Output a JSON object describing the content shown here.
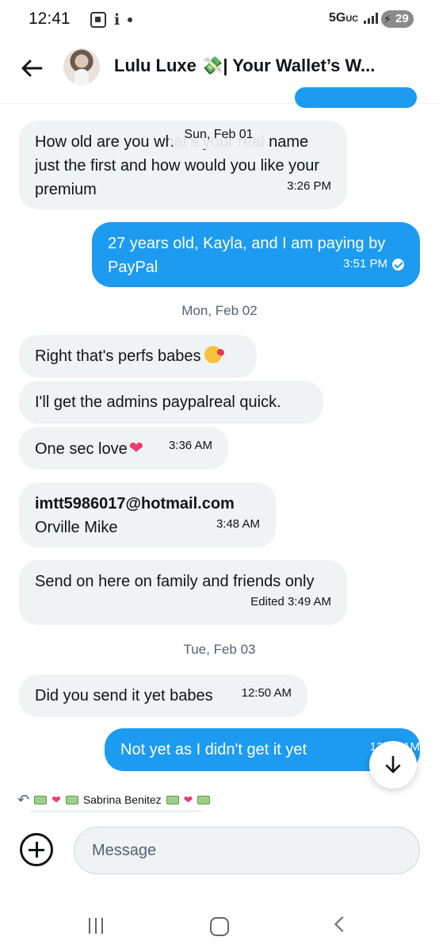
{
  "status_bar": {
    "time": "12:41",
    "network": "5G",
    "network_sub": "UC",
    "battery": "29"
  },
  "header": {
    "title": "Lulu Luxe 💸| Your Wallet’s W..."
  },
  "floating_date": "Sun, Feb 01",
  "messages": [
    {
      "direction": "in",
      "text": "How old are you what's your real name just the first and how would you like your premium",
      "time": "3:26 PM"
    },
    {
      "direction": "out",
      "text": "27 years old, Kayla, and I am paying by PayPal",
      "time": "3:51 PM",
      "status": "read"
    },
    {
      "type": "date",
      "text": "Mon, Feb 02"
    },
    {
      "direction": "in",
      "text": "Right that's perfs babes"
    },
    {
      "direction": "in",
      "text": "I'll get the admins paypalreal quick."
    },
    {
      "direction": "in",
      "text": "One sec love",
      "time": "3:36 AM"
    },
    {
      "direction": "in",
      "line1": "imtt5986017@hotmail.com",
      "line2": "Orville Mike",
      "time": "3:48 AM"
    },
    {
      "direction": "in",
      "text": "Send on here on family and friends only",
      "time": "Edited 3:49 AM"
    },
    {
      "type": "date",
      "text": "Tue, Feb 03"
    },
    {
      "direction": "in",
      "text": "Did you send it yet babes",
      "time": "12:50 AM"
    },
    {
      "direction": "out",
      "text": "Not yet as I didn't get it yet",
      "time": "12:56 AM"
    }
  ],
  "reply_preview": {
    "name": "Sabrina Benitez"
  },
  "composer": {
    "placeholder": "Message"
  },
  "icons": {
    "back": "arrow-left-icon",
    "add": "plus-circle-icon",
    "scroll": "arrow-down-icon"
  },
  "colors": {
    "outgoing_bubble": "#1d9bf0",
    "incoming_bubble": "#eff3f4"
  }
}
